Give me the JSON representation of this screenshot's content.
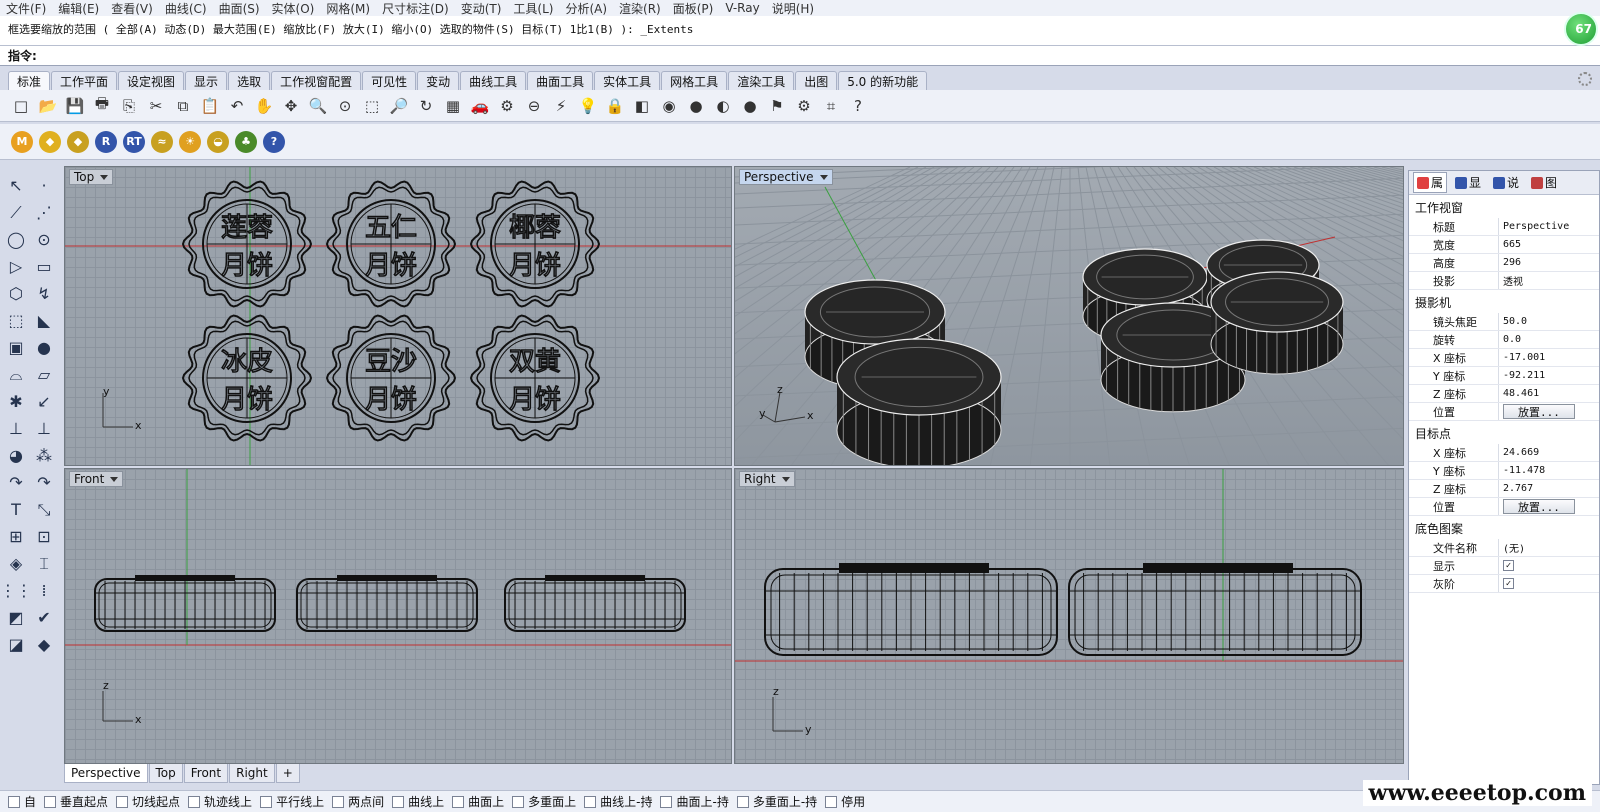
{
  "menu": [
    "文件(F)",
    "编辑(E)",
    "查看(V)",
    "曲线(C)",
    "曲面(S)",
    "实体(O)",
    "网格(M)",
    "尺寸标注(D)",
    "变动(T)",
    "工具(L)",
    "分析(A)",
    "渲染(R)",
    "面板(P)",
    "V-Ray",
    "说明(H)"
  ],
  "command": {
    "history": "框选要缩放的范围 ( 全部(A)  动态(D)  最大范围(E)  缩放比(F)  放大(I)  缩小(O)  选取的物件(S)  目标(T)  1比1(B) ): _Extents",
    "prompt": "指令:",
    "input_value": ""
  },
  "badge": "67",
  "tabs": [
    "标准",
    "工作平面",
    "设定视图",
    "显示",
    "选取",
    "工作视窗配置",
    "可见性",
    "变动",
    "曲线工具",
    "曲面工具",
    "实体工具",
    "网格工具",
    "渲染工具",
    "出图",
    "5.0 的新功能"
  ],
  "toolbar1": [
    "□",
    "📂",
    "💾",
    "🖶",
    "⎘",
    "✂",
    "⧉",
    "📋",
    "↶",
    "✋",
    "✥",
    "🔍",
    "⊙",
    "⬚",
    "🔎",
    "↻",
    "▦",
    "🚗",
    "⚙",
    "⊖",
    "⚡",
    "💡",
    "🔒",
    "◧",
    "◉",
    "●",
    "◐",
    "●",
    "⚑",
    "⚙",
    "⌗",
    "?"
  ],
  "toolbar2": [
    {
      "name": "vray-m-icon",
      "label": "M",
      "color": "#e8a020"
    },
    {
      "name": "vray-tag-icon",
      "label": "◆",
      "color": "#e0b020"
    },
    {
      "name": "vray-tag2-icon",
      "label": "◆",
      "color": "#c8a020"
    },
    {
      "name": "vray-r-icon",
      "label": "R",
      "color": "#3355aa"
    },
    {
      "name": "vray-rt-icon",
      "label": "RT",
      "color": "#3355aa"
    },
    {
      "name": "vray-lights-icon",
      "label": "≈",
      "color": "#c8a020"
    },
    {
      "name": "vray-sun-icon",
      "label": "☀",
      "color": "#e0a020"
    },
    {
      "name": "vray-dome-icon",
      "label": "◒",
      "color": "#c8a020"
    },
    {
      "name": "vray-tree-icon",
      "label": "♣",
      "color": "#4a8a2a"
    },
    {
      "name": "vray-help-icon",
      "label": "?",
      "color": "#3355aa"
    }
  ],
  "left_tools": [
    "↖",
    "·",
    "⟋",
    "⋰",
    "◯",
    "⊙",
    "▷",
    "▭",
    "⬡",
    "↯",
    "⬚",
    "◣",
    "▣",
    "●",
    "⌓",
    "▱",
    "✱",
    "↙",
    "⊥",
    "⊥",
    "◕",
    "⁂",
    "↷",
    "↷",
    "T",
    "⤡",
    "⊞",
    "⊡",
    "◈",
    "⌶",
    "⋮⋮",
    "⁞",
    "◩",
    "✔",
    "◪",
    "◆"
  ],
  "viewports": {
    "top": {
      "label": "Top"
    },
    "perspective": {
      "label": "Perspective"
    },
    "front": {
      "label": "Front"
    },
    "right": {
      "label": "Right"
    }
  },
  "axes": {
    "top": [
      "y",
      "x"
    ],
    "perspective": [
      "z",
      "y",
      "x"
    ],
    "front": [
      "z",
      "x"
    ],
    "right": [
      "z",
      "y"
    ]
  },
  "mooncake_text": [
    [
      "莲蓉",
      "月饼"
    ],
    [
      "五仁",
      "月饼"
    ],
    [
      "椰蓉",
      "月饼"
    ],
    [
      "冰皮",
      "月饼"
    ],
    [
      "豆沙",
      "月饼"
    ],
    [
      "双黄",
      "月饼"
    ]
  ],
  "bottom_tabs": [
    "Perspective",
    "Top",
    "Front",
    "Right",
    "+"
  ],
  "status_snaps": [
    "自",
    "垂直起点",
    "切线起点",
    "轨迹线上",
    "平行线上",
    "两点间",
    "曲线上",
    "曲面上",
    "多重面上",
    "曲线上-持",
    "曲面上-持",
    "多重面上-持",
    "停用"
  ],
  "panel": {
    "tabs": [
      {
        "label": "属",
        "color": "#e04040"
      },
      {
        "label": "显",
        "color": "#3355aa"
      },
      {
        "label": "说",
        "color": "#3355aa"
      },
      {
        "label": "图",
        "color": "#c04040"
      }
    ],
    "section_viewport": "工作视窗",
    "rows_viewport": [
      {
        "k": "标题",
        "v": "Perspective"
      },
      {
        "k": "宽度",
        "v": "665"
      },
      {
        "k": "高度",
        "v": "296"
      },
      {
        "k": "投影",
        "v": "透视"
      }
    ],
    "section_camera": "摄影机",
    "rows_camera": [
      {
        "k": "镜头焦距",
        "v": "50.0"
      },
      {
        "k": "旋转",
        "v": "0.0"
      },
      {
        "k": "X 座标",
        "v": "-17.001"
      },
      {
        "k": "Y 座标",
        "v": "-92.211"
      },
      {
        "k": "Z 座标",
        "v": "48.461"
      },
      {
        "k": "位置",
        "v": "放置..."
      }
    ],
    "section_target": "目标点",
    "rows_target": [
      {
        "k": "X 座标",
        "v": "24.669"
      },
      {
        "k": "Y 座标",
        "v": "-11.478"
      },
      {
        "k": "Z 座标",
        "v": "2.767"
      },
      {
        "k": "位置",
        "v": "放置..."
      }
    ],
    "section_bg": "底色图案",
    "rows_bg": [
      {
        "k": "文件名称",
        "v": "(无)"
      },
      {
        "k": "显示",
        "v": "✓"
      },
      {
        "k": "灰阶",
        "v": "✓"
      }
    ]
  },
  "watermark": "www.eeeetop.com"
}
